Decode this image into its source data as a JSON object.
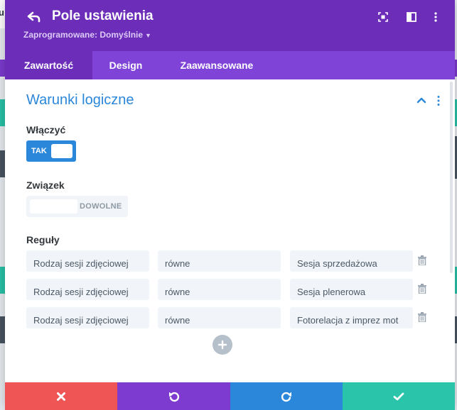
{
  "background": {
    "corner_letter": "u"
  },
  "header": {
    "title": "Pole ustawienia",
    "preset_label": "Zaprogramowane: Domyślnie",
    "icons": [
      "back-icon",
      "expand-icon",
      "sidebar-layout-icon",
      "more-vertical-icon"
    ]
  },
  "tabs": [
    {
      "label": "Zawartość",
      "active": true
    },
    {
      "label": "Design",
      "active": false
    },
    {
      "label": "Zaawansowane",
      "active": false
    }
  ],
  "section": {
    "title": "Warunki logiczne",
    "enable": {
      "label": "Włączyć",
      "value": "TAK",
      "state": "on"
    },
    "relation": {
      "label": "Związek",
      "value": "DOWOLNE"
    },
    "rules": {
      "label": "Reguły",
      "items": [
        {
          "field": "Rodzaj sesji zdjęciowej",
          "condition": "równe",
          "value": "Sesja sprzedażowa"
        },
        {
          "field": "Rodzaj sesji zdjęciowej",
          "condition": "równe",
          "value": "Sesja plenerowa"
        },
        {
          "field": "Rodzaj sesji zdjęciowej",
          "condition": "równe",
          "value": "Fotorelacja z imprez mot"
        }
      ]
    }
  },
  "footer": {
    "buttons": [
      {
        "icon": "close-icon",
        "color": "#ef5555"
      },
      {
        "icon": "undo-icon",
        "color": "#7e3bd0"
      },
      {
        "icon": "redo-icon",
        "color": "#2b87da"
      },
      {
        "icon": "check-icon",
        "color": "#29c4a9"
      }
    ]
  },
  "colors": {
    "header": "#6c2eb9",
    "tabs": "#8043d8",
    "accent_blue": "#2b87da",
    "field_bg": "#f1f5f9"
  }
}
